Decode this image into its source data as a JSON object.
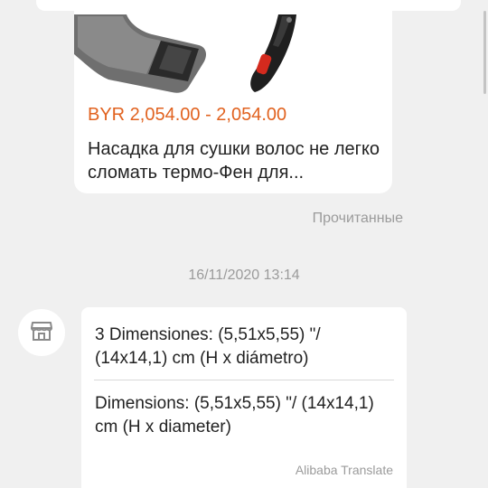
{
  "product_card": {
    "price": "BYR 2,054.00 - 2,054.00",
    "title": "Насадка для сушки волос не легко сломать термо-Фен для..."
  },
  "read_status": "Прочитанные",
  "timestamp": "16/11/2020 13:14",
  "message": {
    "avatar_icon": "store-icon",
    "original_text": "3 Dimensiones: (5,51x5,55) \"/ (14x14,1) cm (H x diámetro)",
    "translated_text": "Dimensions: (5,51x5,55) \"/ (14x14,1) cm (H x diameter)",
    "translate_credit": "Alibaba Translate"
  },
  "colors": {
    "price": "#e1621f",
    "background": "#f0f0f0",
    "muted_text": "#9b9b9b",
    "accent_red": "#d42a1e"
  }
}
